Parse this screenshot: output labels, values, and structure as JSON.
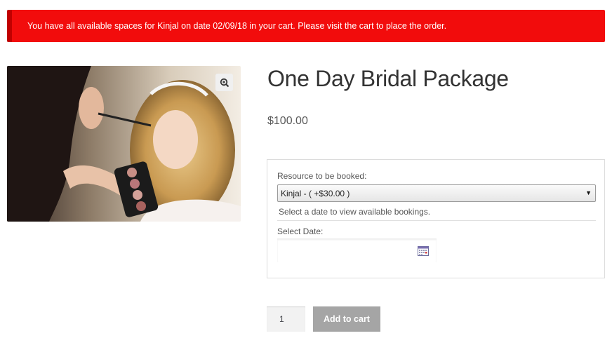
{
  "notice": {
    "message": "You have all available spaces for Kinjal on date 02/09/18 in your cart. Please visit the cart to place the order.",
    "background_color": "#f20c0c"
  },
  "product": {
    "title": "One Day Bridal Package",
    "price": "$100.00",
    "zoom_icon": "zoom-in-icon"
  },
  "booking": {
    "resource_label": "Resource to be booked:",
    "resource_selected": "Kinjal - ( +$30.00 )",
    "resource_arrow": "▼",
    "help_text": "Select a date to view available bookings.",
    "date_label": "Select Date:",
    "date_value": "",
    "calendar_icon": "calendar-icon"
  },
  "cart": {
    "quantity": "1",
    "add_to_cart_label": "Add to cart",
    "button_color": "#a5a5a5"
  }
}
